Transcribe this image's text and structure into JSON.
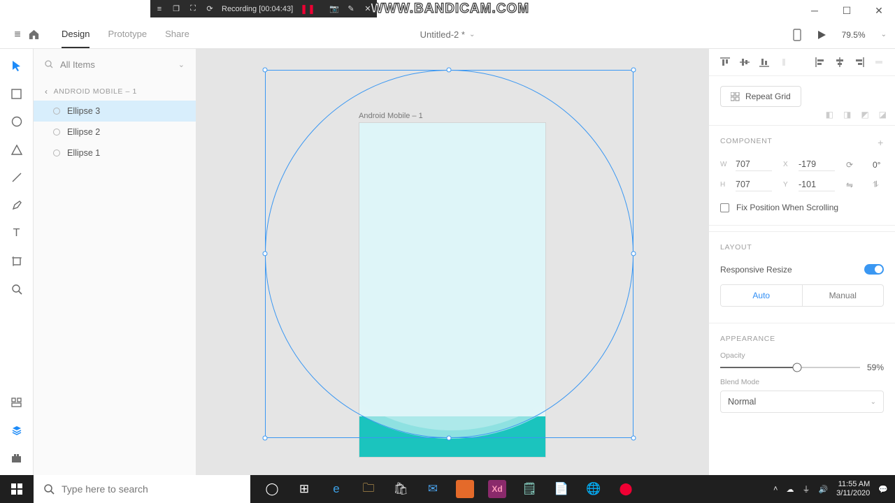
{
  "bandicam": {
    "recording": "Recording [00:04:43]",
    "watermark": "WWW.BANDICAM.COM"
  },
  "app": {
    "tabs": {
      "design": "Design",
      "prototype": "Prototype",
      "share": "Share"
    },
    "document": "Untitled-2 *",
    "zoom": "79.5%"
  },
  "layers": {
    "search_label": "All Items",
    "breadcrumb": "ANDROID MOBILE – 1",
    "items": [
      {
        "label": "Ellipse 3"
      },
      {
        "label": "Ellipse 2"
      },
      {
        "label": "Ellipse 1"
      }
    ]
  },
  "canvas": {
    "artboard_label": "Android Mobile – 1"
  },
  "inspector": {
    "repeat_grid": "Repeat Grid",
    "component_label": "COMPONENT",
    "w": "707",
    "h": "707",
    "x": "-179",
    "y": "-101",
    "rotation": "0°",
    "fix_position": "Fix Position When Scrolling",
    "layout_label": "LAYOUT",
    "responsive": "Responsive Resize",
    "auto": "Auto",
    "manual": "Manual",
    "appearance_label": "APPEARANCE",
    "opacity_label": "Opacity",
    "opacity_value": "59%",
    "blend_label": "Blend Mode",
    "blend_value": "Normal"
  },
  "taskbar": {
    "search_placeholder": "Type here to search",
    "time": "11:55 AM",
    "date": "3/11/2020"
  }
}
